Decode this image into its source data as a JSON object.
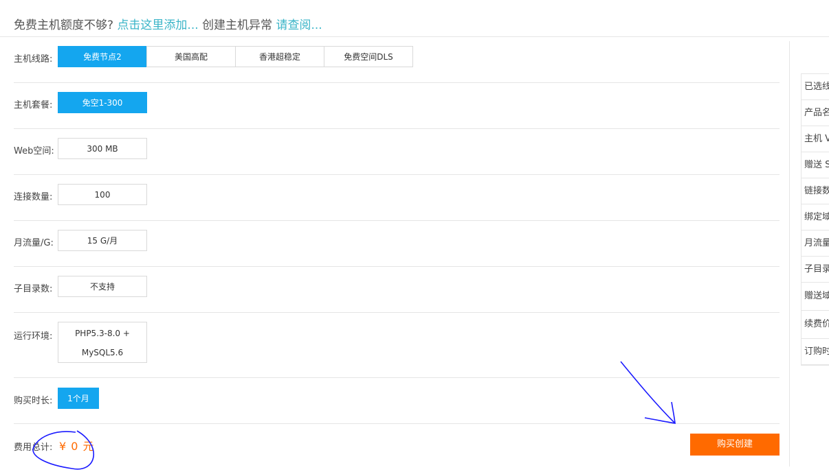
{
  "notice": {
    "text1": "免费主机额度不够?",
    "link1": "点击这里添加...",
    "text2": "创建主机异常",
    "link2": "请查阅..."
  },
  "form": {
    "line": {
      "label": "主机线路:",
      "options": [
        "免费节点2",
        "美国高配",
        "香港超稳定",
        "免费空间DLS"
      ],
      "selected": 0
    },
    "package": {
      "label": "主机套餐:",
      "value": "免空1-300"
    },
    "web_space": {
      "label": "Web空间:",
      "value": "300 MB"
    },
    "connections": {
      "label": "连接数量:",
      "value": "100"
    },
    "traffic": {
      "label": "月流量/G:",
      "value": "15 G/月"
    },
    "subdirs": {
      "label": "子目录数:",
      "value": "不支持"
    },
    "runtime": {
      "label": "运行环境:",
      "value_line1": "PHP5.3-8.0 +",
      "value_line2": "MySQL5.6"
    },
    "duration": {
      "label": "购买时长:",
      "value": "1个月"
    },
    "total": {
      "label": "费用总计:",
      "value": "¥ 0 元"
    }
  },
  "buy_button": "购买创建",
  "summary_panel": {
    "rows": [
      "已选线",
      "产品名",
      "主机 V",
      "赠送 S",
      "链接数",
      "绑定域",
      "月流量",
      "子目录",
      "赠送域",
      "续费价",
      "订购时"
    ]
  },
  "colors": {
    "accent_blue": "#14a6ef",
    "orange": "#ff6a00",
    "link": "#3bb5c8",
    "annotation": "#1a1aff"
  }
}
